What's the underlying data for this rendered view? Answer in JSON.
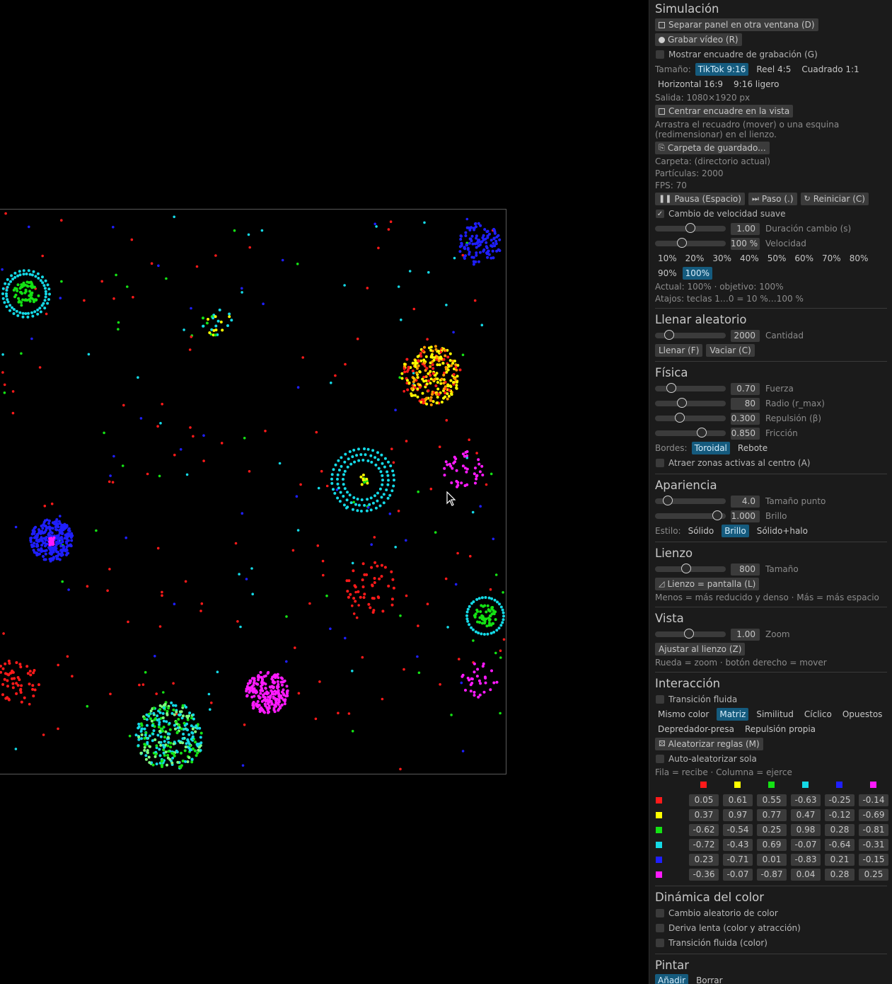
{
  "colors": {
    "red": "#ff1a1a",
    "yellow": "#ffff00",
    "green": "#14e214",
    "cyan": "#14d9e6",
    "blue": "#1f1fff",
    "magenta": "#ff1aff",
    "accent": "#155b7e"
  },
  "simulacion": {
    "title": "Simulación",
    "separar": "Separar panel en otra ventana (D)",
    "grabar": "Grabar vídeo (R)",
    "mostrar_encuadre": "Mostrar encuadre de grabación (G)",
    "tamano_label": "Tamaño:",
    "tamano_options": [
      "TikTok 9:16",
      "Reel 4:5",
      "Cuadrado 1:1",
      "Horizontal 16:9",
      "9:16 ligero"
    ],
    "tamano_selected": "TikTok 9:16",
    "salida": "Salida: 1080×1920 px",
    "centrar": "Centrar encuadre en la vista",
    "help_line1": "Arrastra el recuadro (mover) o una esquina",
    "help_line2": "(redimensionar) en el lienzo.",
    "carpeta_btn": "Carpeta de guardado...",
    "carpeta": "Carpeta: (directorio actual)",
    "particulas": "Partículas: 2000",
    "fps": "FPS: 70",
    "pausa": "Pausa (Espacio)",
    "paso": "Paso (.)",
    "reiniciar": "Reiniciar (C)",
    "cambio_suave": "Cambio de velocidad suave",
    "cambio_suave_checked": true,
    "duracion_value": "1.00",
    "duracion_label": "Duración cambio (s)",
    "duracion_level": 0.5,
    "velocidad_value": "100 %",
    "velocidad_label": "Velocidad",
    "velocidad_level": 0.36,
    "speed_options": [
      "10%",
      "20%",
      "30%",
      "40%",
      "50%",
      "60%",
      "70%",
      "80%",
      "90%",
      "100%"
    ],
    "speed_selected": "100%",
    "actual": "Actual: 100%  ·  objetivo: 100%",
    "atajos": "Atajos: teclas 1…0 = 10 %…100 %"
  },
  "llenar": {
    "title": "Llenar aleatorio",
    "cantidad_value": "2000",
    "cantidad_label": "Cantidad",
    "cantidad_level": 0.15,
    "llenar_btn": "Llenar (F)",
    "vaciar_btn": "Vaciar (C)"
  },
  "fisica": {
    "title": "Física",
    "fuerza_value": "0.70",
    "fuerza_label": "Fuerza",
    "fuerza_level": 0.19,
    "radio_value": "80",
    "radio_label": "Radio (r_max)",
    "radio_level": 0.36,
    "repulsion_value": "0.300",
    "repulsion_label": "Repulsión (β)",
    "repulsion_level": 0.32,
    "friccion_value": "0.850",
    "friccion_label": "Fricción",
    "friccion_level": 0.69,
    "bordes_label": "Bordes:",
    "bordes_options": [
      "Toroidal",
      "Rebote"
    ],
    "bordes_selected": "Toroidal",
    "atraer": "Atraer zonas activas al centro (A)"
  },
  "apariencia": {
    "title": "Apariencia",
    "punto_value": "4.0",
    "punto_label": "Tamaño punto",
    "punto_level": 0.13,
    "brillo_value": "1.000",
    "brillo_label": "Brillo",
    "brillo_level": 0.94,
    "estilo_label": "Estilo:",
    "estilo_options": [
      "Sólido",
      "Brillo",
      "Sólido+halo"
    ],
    "estilo_selected": "Brillo"
  },
  "lienzo": {
    "title": "Lienzo",
    "tamano_value": "800",
    "tamano_label": "Tamaño",
    "tamano_level": 0.43,
    "pantalla_btn": "Lienzo = pantalla (L)",
    "help": "Menos = más reducido y denso · Más = más espacio"
  },
  "vista": {
    "title": "Vista",
    "zoom_value": "1.00",
    "zoom_label": "Zoom",
    "zoom_level": 0.48,
    "ajustar_btn": "Ajustar al lienzo (Z)",
    "help": "Rueda = zoom · botón derecho = mover"
  },
  "interaccion": {
    "title": "Interacción",
    "transicion": "Transición fluida",
    "modes_row1": [
      "Mismo color",
      "Matriz",
      "Similitud",
      "Cíclico",
      "Opuestos"
    ],
    "modes_row2": [
      "Depredador-presa",
      "Repulsión propia"
    ],
    "mode_selected": "Matriz",
    "aleatorizar_btn": "Aleatorizar reglas (M)",
    "auto": "Auto-aleatorizar sola",
    "fila_columna": "Fila = recibe · Columna = ejerce",
    "matrix": [
      [
        "0.05",
        "0.61",
        "0.55",
        "-0.63",
        "-0.25",
        "-0.14"
      ],
      [
        "0.37",
        "0.97",
        "0.77",
        "0.47",
        "-0.12",
        "-0.69"
      ],
      [
        "-0.62",
        "-0.54",
        "0.25",
        "0.98",
        "0.28",
        "-0.81"
      ],
      [
        "-0.72",
        "-0.43",
        "0.69",
        "-0.07",
        "-0.64",
        "-0.31"
      ],
      [
        "0.23",
        "-0.71",
        "0.01",
        "-0.83",
        "0.21",
        "-0.15"
      ],
      [
        "-0.36",
        "-0.07",
        "-0.87",
        "0.04",
        "0.28",
        "0.25"
      ]
    ]
  },
  "dinamica": {
    "title": "Dinámica del color",
    "cambio": "Cambio aleatorio de color",
    "deriva": "Deriva lenta (color y atracción)",
    "transicion": "Transición fluida (color)"
  },
  "pintar": {
    "title": "Pintar",
    "options": [
      "Añadir",
      "Borrar"
    ],
    "selected": "Añadir"
  }
}
